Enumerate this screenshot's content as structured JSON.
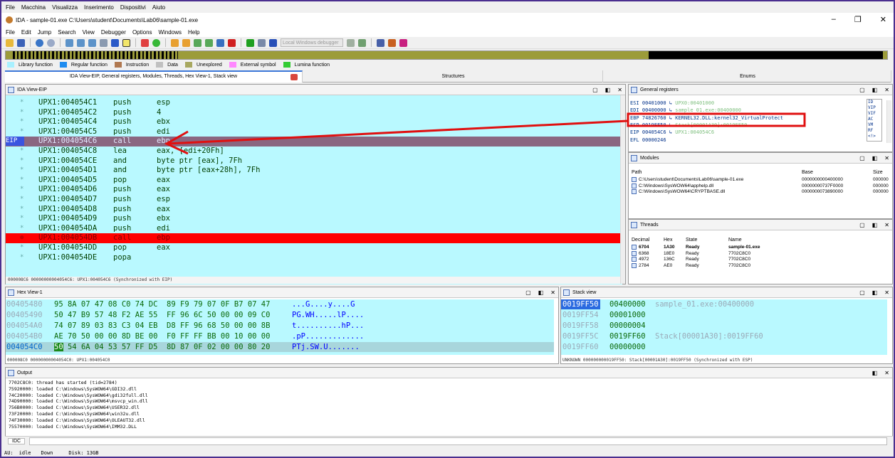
{
  "vbox_menu": [
    "File",
    "Macchina",
    "Visualizza",
    "Inserimento",
    "Dispositivi",
    "Aiuto"
  ],
  "title": "IDA - sample-01.exe C:\\Users\\student\\Documents\\Lab06\\sample-01.exe",
  "window_controls": {
    "minimize": "–",
    "restore": "❐",
    "close": "✕"
  },
  "ida_menu": [
    "File",
    "Edit",
    "Jump",
    "Search",
    "View",
    "Debugger",
    "Options",
    "Windows",
    "Help"
  ],
  "toolbar": {
    "debugger": "Local Windows debugger"
  },
  "legend": [
    {
      "label": "Library function",
      "color": "#a8f0ff"
    },
    {
      "label": "Regular function",
      "color": "#1e8cf0"
    },
    {
      "label": "Instruction",
      "color": "#b07850"
    },
    {
      "label": "Data",
      "color": "#c0c0c0"
    },
    {
      "label": "Unexplored",
      "color": "#a8a860"
    },
    {
      "label": "External symbol",
      "color": "#ff88ff"
    },
    {
      "label": "Lumina function",
      "color": "#33cc33"
    }
  ],
  "tabs": [
    "IDA View-EIP, General registers, Modules, Threads, Hex View-1, Stack view",
    "Structures",
    "Enums"
  ],
  "disasm": {
    "title": "IDA View-EIP",
    "eip_tag": "EIP",
    "lines": [
      {
        "addr": "UPX1:004054C1",
        "mn": "push",
        "op": "esp"
      },
      {
        "addr": "UPX1:004054C2",
        "mn": "push",
        "op": "4"
      },
      {
        "addr": "UPX1:004054C4",
        "mn": "push",
        "op": "ebx"
      },
      {
        "addr": "UPX1:004054C5",
        "mn": "push",
        "op": "edi"
      },
      {
        "addr": "UPX1:004054C6",
        "mn": "call",
        "op": "ebp"
      },
      {
        "addr": "UPX1:004054C8",
        "mn": "lea",
        "op": "eax, [edi+20Fh]"
      },
      {
        "addr": "UPX1:004054CE",
        "mn": "and",
        "op": "byte ptr [eax], 7Fh"
      },
      {
        "addr": "UPX1:004054D1",
        "mn": "and",
        "op": "byte ptr [eax+28h], 7Fh"
      },
      {
        "addr": "UPX1:004054D5",
        "mn": "pop",
        "op": "eax"
      },
      {
        "addr": "UPX1:004054D6",
        "mn": "push",
        "op": "eax"
      },
      {
        "addr": "UPX1:004054D7",
        "mn": "push",
        "op": "esp"
      },
      {
        "addr": "UPX1:004054D8",
        "mn": "push",
        "op": "eax"
      },
      {
        "addr": "UPX1:004054D9",
        "mn": "push",
        "op": "ebx"
      },
      {
        "addr": "UPX1:004054DA",
        "mn": "push",
        "op": "edi"
      },
      {
        "addr": "UPX1:004054DB",
        "mn": "call",
        "op": "ebp"
      },
      {
        "addr": "UPX1:004054DD",
        "mn": "pop",
        "op": "eax"
      },
      {
        "addr": "UPX1:004054DE",
        "mn": "popa",
        "op": ""
      }
    ],
    "status": "000008C6 00000000004054C6: UPX1:004054C6 (Synchronized with EIP)"
  },
  "regs": {
    "title": "General registers",
    "rows": [
      {
        "name": "ESI",
        "val": "00401000",
        "arrow": "↳",
        "desc": "UPX0:00401000"
      },
      {
        "name": "EDI",
        "val": "00400000",
        "arrow": "↳",
        "desc": "sample_01.exe:00400000"
      },
      {
        "name": "EBP",
        "val": "74826760",
        "arrow": "↳",
        "desc": "KERNEL32.DLL:kernel32_VirtualProtect"
      },
      {
        "name": "ESP",
        "val": "0019FF50",
        "arrow": "↳",
        "desc": "Stack[00001A30]:0019FF50"
      },
      {
        "name": "EIP",
        "val": "004054C6",
        "arrow": "↳",
        "desc": "UPX1:004054C6"
      },
      {
        "name": "EFL",
        "val": "00000246",
        "arrow": "",
        "desc": ""
      }
    ],
    "flags": [
      "ID",
      "VIP",
      "VIF",
      "AC",
      "VM",
      "RF",
      "<!>"
    ]
  },
  "modules": {
    "title": "Modules",
    "headers": [
      "Path",
      "Base",
      "Size"
    ],
    "rows": [
      {
        "path": "C:\\Users\\student\\Documents\\Lab06\\sample-01.exe",
        "base": "0000000000400000",
        "size": "000000"
      },
      {
        "path": "C:\\Windows\\SysWOW64\\apphelp.dll",
        "base": "00000000737F0000",
        "size": "000000"
      },
      {
        "path": "C:\\Windows\\SysWOW64\\CRYPTBASE.dll",
        "base": "0000000073890000",
        "size": "000000"
      }
    ]
  },
  "threads": {
    "title": "Threads",
    "headers": [
      "Decimal",
      "Hex",
      "State",
      "Name"
    ],
    "rows": [
      {
        "dec": "6704",
        "hex": "1A30",
        "state": "Ready",
        "name": "sample-01.exe"
      },
      {
        "dec": "6368",
        "hex": "18E0",
        "state": "Ready",
        "name": "7702C8C0"
      },
      {
        "dec": "4972",
        "hex": "136C",
        "state": "Ready",
        "name": "7702C8C0"
      },
      {
        "dec": "2784",
        "hex": "AE0",
        "state": "Ready",
        "name": "7702C8C0"
      }
    ]
  },
  "hex": {
    "title": "Hex View-1",
    "rows": [
      {
        "addr": "00405480",
        "bytes": "95 8A 07 47 08 C0 74 DC  89 F9 79 07 0F B7 07 47",
        "ascii": "...G....y....G"
      },
      {
        "addr": "00405490",
        "bytes": "50 47 B9 57 48 F2 AE 55  FF 96 6C 50 00 00 09 C0",
        "ascii": "PG.WH.....lP...."
      },
      {
        "addr": "004054A0",
        "bytes": "74 07 89 03 83 C3 04 EB  D8 FF 96 68 50 00 00 8B",
        "ascii": "t..........hP..."
      },
      {
        "addr": "004054B0",
        "bytes": "AE 70 50 00 00 8D BE 00  F0 FF FF BB 00 10 00 00",
        "ascii": ".pP............."
      },
      {
        "addr": "004054C0",
        "sel": "50",
        "bytes": " 54 6A 04 53 57 FF D5  8D 87 0F 02 00 00 80 20",
        "ascii": "PTj.SW.U......."
      }
    ],
    "status": "000008C0 00000000004054C0: UPX1:004054C0"
  },
  "stack": {
    "title": "Stack view",
    "rows": [
      {
        "addr": "0019FF50",
        "val": "00400000",
        "desc": "sample_01.exe:00400000"
      },
      {
        "addr": "0019FF54",
        "val": "00001000",
        "desc": ""
      },
      {
        "addr": "0019FF58",
        "val": "00000004",
        "desc": ""
      },
      {
        "addr": "0019FF5C",
        "val": "0019FF60",
        "desc": "Stack[00001A30]:0019FF60"
      },
      {
        "addr": "0019FF60",
        "val": "00000000",
        "desc": ""
      }
    ],
    "status": "UNKNOWN 000000000019FF50: Stack[00001A30]:0019FF50 (Synchronized with ESP)"
  },
  "output": {
    "title": "Output",
    "lines": [
      "7702C8C0: thread has started (tid=2784)",
      "75920000: loaded C:\\Windows\\SysWOW64\\GDI32.dll",
      "74C20000: loaded C:\\Windows\\SysWOW64\\gdi32full.dll",
      "74D90000: loaded C:\\Windows\\SysWOW64\\msvcp_win.dll",
      "756B0000: loaded C:\\Windows\\SysWOW64\\USER32.dll",
      "73F20000: loaded C:\\Windows\\SysWOW64\\win32u.dll",
      "74F30000: loaded C:\\Windows\\SysWOW64\\OLEAUT32.dll",
      "75570000: loaded C:\\Windows\\SysWOW64\\IMM32.DLL"
    ]
  },
  "idc_label": "IDC",
  "statusbar": {
    "au": "AU:",
    "state": "idle",
    "dir": "Down",
    "disk": "Disk: 13GB"
  }
}
